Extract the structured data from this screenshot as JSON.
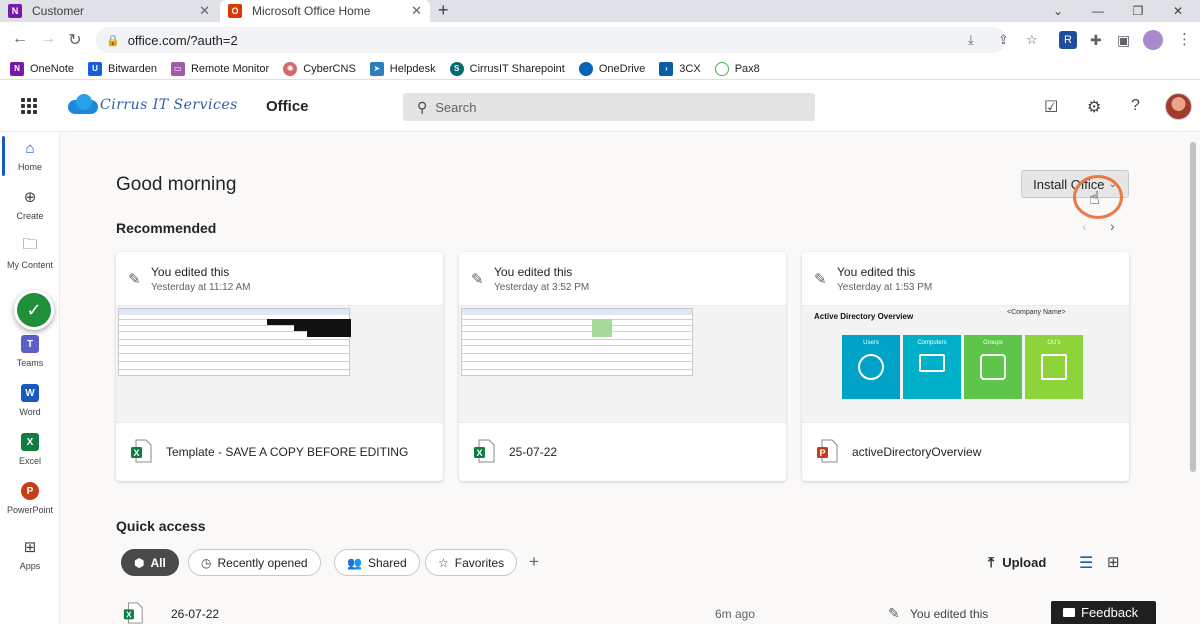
{
  "browser": {
    "tabs": [
      {
        "title": "Customer",
        "icon": "onenote-icon"
      },
      {
        "title": "Microsoft Office Home",
        "icon": "office-icon"
      }
    ],
    "url": "office.com/?auth=2",
    "bookmarks": [
      {
        "label": "OneNote",
        "icon": "onenote-icon",
        "color": "#7719aa"
      },
      {
        "label": "Bitwarden",
        "icon": "shield-icon",
        "color": "#175ddc"
      },
      {
        "label": "Remote Monitor",
        "icon": "monitor-icon",
        "color": "#a05ca8"
      },
      {
        "label": "CyberCNS",
        "icon": "gear-icon",
        "color": "#d46a6a"
      },
      {
        "label": "Helpdesk",
        "icon": "bird-icon",
        "color": "#2b7fbf"
      },
      {
        "label": "CirrusIT Sharepoint",
        "icon": "sharepoint-icon",
        "color": "#036c70"
      },
      {
        "label": "OneDrive",
        "icon": "cloud-icon",
        "color": "#0364b8"
      },
      {
        "label": "3CX",
        "icon": "chevron-icon",
        "color": "#0a5ea8"
      },
      {
        "label": "Pax8",
        "icon": "ring-icon",
        "color": "#4caf50"
      }
    ]
  },
  "header": {
    "brand": "Cirrus IT Services",
    "app_title": "Office",
    "search_placeholder": "Search"
  },
  "rail": {
    "items": [
      {
        "label": "Home",
        "icon": "home-icon"
      },
      {
        "label": "Create",
        "icon": "plus-circle-icon"
      },
      {
        "label": "My Content",
        "icon": "folder-icon"
      },
      {
        "label": "Teams",
        "icon": "teams-icon"
      },
      {
        "label": "Word",
        "icon": "word-icon"
      },
      {
        "label": "Excel",
        "icon": "excel-icon"
      },
      {
        "label": "PowerPoint",
        "icon": "powerpoint-icon"
      },
      {
        "label": "Apps",
        "icon": "apps-icon"
      }
    ]
  },
  "main": {
    "greeting": "Good morning",
    "install_label": "Install Office",
    "recommended_title": "Recommended",
    "cards": [
      {
        "activity": "You edited this",
        "time": "Yesterday at 11:12 AM",
        "file": "Template - SAVE A COPY BEFORE EDITING",
        "type": "excel"
      },
      {
        "activity": "You edited this",
        "time": "Yesterday at 3:52 PM",
        "file": "25-07-22",
        "type": "excel"
      },
      {
        "activity": "You edited this",
        "time": "Yesterday at 1:53 PM",
        "file": "activeDirectoryOverview",
        "type": "powerpoint"
      }
    ],
    "ad_preview": {
      "title": "Active Directory Overview",
      "company": "<Company Name>",
      "tiles": [
        {
          "label": "Users",
          "color": "#00a2c8"
        },
        {
          "label": "Computers",
          "color": "#00b0c8"
        },
        {
          "label": "Groups",
          "color": "#5cc54a"
        },
        {
          "label": "OU's",
          "color": "#8cd43a"
        }
      ]
    },
    "quick_access_title": "Quick access",
    "filters": [
      {
        "label": "All",
        "icon": "cube-icon",
        "active": true
      },
      {
        "label": "Recently opened",
        "icon": "clock-icon",
        "active": false
      },
      {
        "label": "Shared",
        "icon": "people-icon",
        "active": false
      },
      {
        "label": "Favorites",
        "icon": "star-icon",
        "active": false
      }
    ],
    "upload_label": "Upload",
    "files": [
      {
        "name": "26-07-22",
        "time": "6m ago",
        "activity": "You edited this",
        "type": "excel"
      }
    ],
    "feedback_label": "Feedback"
  },
  "colors": {
    "accent": "#185abd",
    "excel": "#107c41",
    "powerpoint": "#c43e1c",
    "cursor_ring": "#e87a48"
  }
}
